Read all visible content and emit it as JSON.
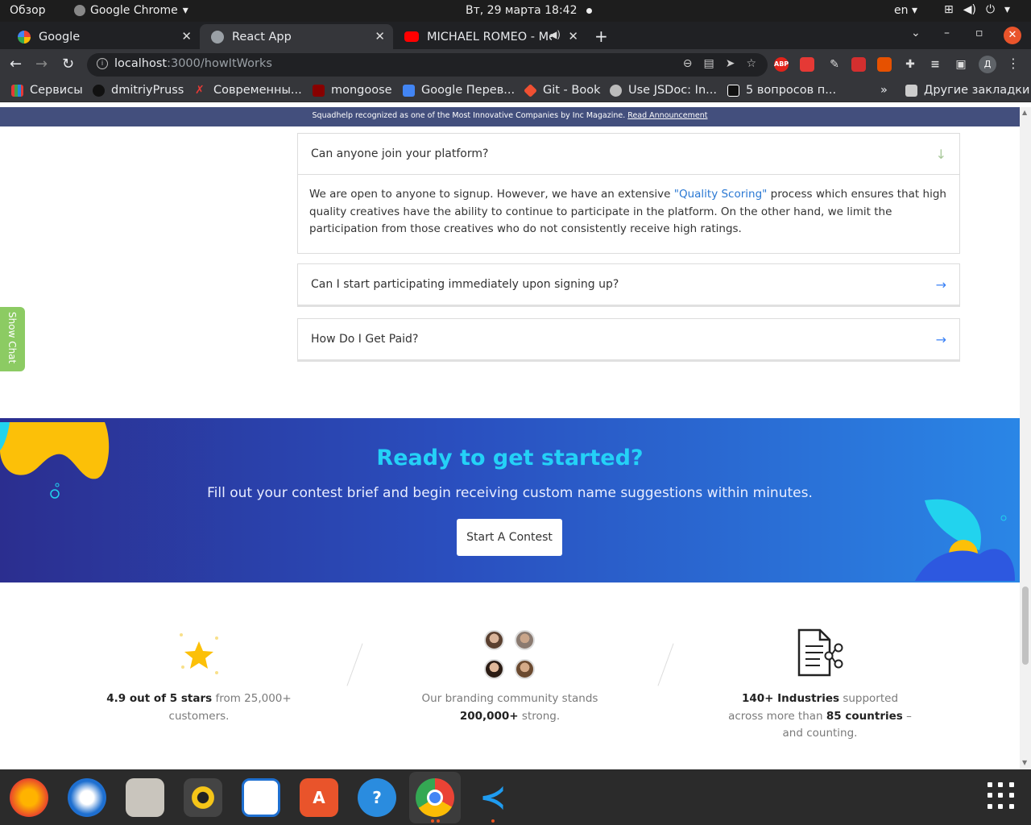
{
  "system": {
    "overview": "Обзор",
    "app_menu": "Google Chrome",
    "clock": "Вт, 29 марта  18:42",
    "lang": "en"
  },
  "tabs": [
    {
      "label": "Google"
    },
    {
      "label": "React App"
    },
    {
      "label": "MICHAEL ROMEO - Me"
    }
  ],
  "address": {
    "host": "localhost",
    "path": ":3000/howItWorks"
  },
  "profile_initial": "Д",
  "bookmarks": [
    {
      "label": "Сервисы"
    },
    {
      "label": "dmitriyPruss"
    },
    {
      "label": "Современны..."
    },
    {
      "label": "mongoose"
    },
    {
      "label": "Google Перев..."
    },
    {
      "label": "Git - Book"
    },
    {
      "label": "Use JSDoc: In..."
    },
    {
      "label": "5 вопросов п..."
    },
    {
      "label": "Другие закладки"
    }
  ],
  "extensions": [
    "ABP"
  ],
  "page": {
    "announcement": "Squadhelp recognized as one of the Most Innovative Companies by Inc Magazine.",
    "announcement_link": "Read Announcement",
    "show_chat": "Show Chat",
    "faq": [
      {
        "question": "Can anyone join your platform?",
        "answer_before": "We are open to anyone to signup. However, we have an extensive ",
        "answer_highlight": "\"Quality Scoring\"",
        "answer_after": " process which ensures that high quality creatives have the ability to continue to participate in the platform. On the other hand, we limit the participation from those creatives who do not consistently receive high ratings."
      },
      {
        "question": "Can I start participating immediately upon signing up?"
      },
      {
        "question": "How Do I Get Paid?"
      }
    ],
    "banner": {
      "title": "Ready to get started?",
      "subtitle": "Fill out your contest brief and begin receiving custom name suggestions within minutes.",
      "cta": "Start A Contest"
    },
    "stats": [
      {
        "bold1": "4.9 out of 5 stars",
        "text1": " from 25,000+ customers."
      },
      {
        "text1": "Our branding community stands ",
        "bold1": "200,000+",
        "text2": " strong."
      },
      {
        "bold1": "140+ Industries",
        "text1": " supported across more than ",
        "bold2": "85 countries",
        "text2": " – and counting."
      }
    ]
  },
  "colors": {
    "banner_title": "#24d1f7",
    "arrow": "#3b82f6",
    "show_chat": "#8ccb63",
    "announce_bg": "#434f7d"
  }
}
